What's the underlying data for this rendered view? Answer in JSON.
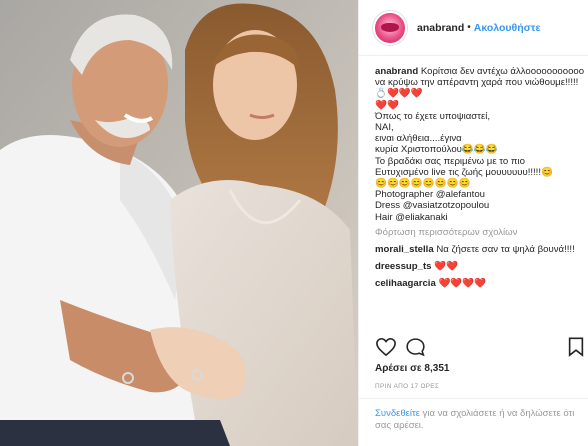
{
  "post": {
    "username": "anabrand",
    "dot": "•",
    "follow_label": "Ακολουθήστε",
    "caption_user": "anabrand",
    "caption_text": " Κορίτσια δεν αντέχω άλλοοοοοοοοοοο να κρύψω την απέραντη χαρά που νιώθουμε!!!!!💍❤️❤️❤️\n❤️❤️\nΌπως το έχετε υποψιαστεί,\nΝΑΙ,\nειναι αλήθεια....έγινα\nκυρία Χριστοπούλου😂😂😂\nΤο βραδάκι σας περιμένω με το πιο\nΕυτυχισμένο live τις ζωής μουυυυυυ!!!!!😊\n😊😊😊😊😊😊😊😊\nPhotographer @alefantou\nDress @vasiatzotzopoulou\nHair @eliakanaki",
    "load_more": "Φόρτωση περισσότερων σχολίων",
    "comments": [
      {
        "user": "morali_stella",
        "text": " Να ζήσετε σαν τα ψηλά βουνά!!!!"
      },
      {
        "user": "dreessup_ts",
        "text": " ❤️❤️"
      },
      {
        "user": "celihaagarcia",
        "text": " ❤️❤️❤️❤️"
      }
    ],
    "likes": "Αρέσει σε 8,351",
    "time": "ΠΡΙΝ ΑΠΟ 17 ΩΡΕΣ",
    "login_link": "Συνδεθείτε",
    "login_text": " για να σχολιάσετε ή να δηλώσετε ότι σας αρέσει."
  },
  "icons": {
    "like": "heart-icon",
    "comment": "comment-icon",
    "save": "bookmark-icon"
  },
  "colors": {
    "link": "#3897f0",
    "text": "#262626",
    "muted": "#999999"
  }
}
